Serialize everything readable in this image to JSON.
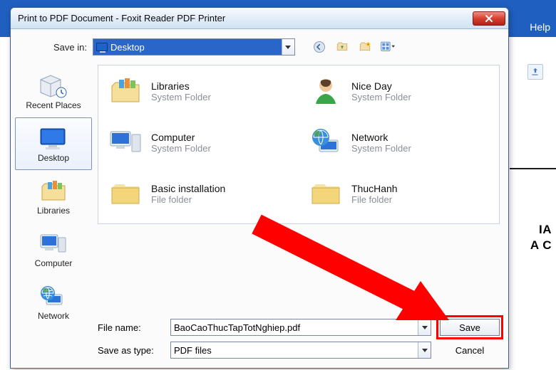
{
  "backdrop": {
    "help": "Help",
    "partial1": "IA",
    "partial2": "A C"
  },
  "dialog": {
    "title": "Print to PDF Document - Foxit Reader PDF Printer",
    "savein_label": "Save in:",
    "savein_value": "Desktop",
    "filename_label": "File name:",
    "filename_value": "BaoCaoThucTapTotNghiep.pdf",
    "filetype_label": "Save as type:",
    "filetype_value": "PDF files",
    "save_btn": "Save",
    "cancel_btn": "Cancel"
  },
  "places": [
    {
      "label": "Recent Places",
      "icon": "recent"
    },
    {
      "label": "Desktop",
      "icon": "desktop",
      "selected": true
    },
    {
      "label": "Libraries",
      "icon": "libraries"
    },
    {
      "label": "Computer",
      "icon": "computer"
    },
    {
      "label": "Network",
      "icon": "network"
    }
  ],
  "items": [
    {
      "name": "Libraries",
      "sub": "System Folder",
      "icon": "libraries"
    },
    {
      "name": "Nice Day",
      "sub": "System Folder",
      "icon": "user"
    },
    {
      "name": "Computer",
      "sub": "System Folder",
      "icon": "computer"
    },
    {
      "name": "Network",
      "sub": "System Folder",
      "icon": "network"
    },
    {
      "name": "Basic installation",
      "sub": "File folder",
      "icon": "folder"
    },
    {
      "name": "ThucHanh",
      "sub": "File folder",
      "icon": "folder"
    }
  ]
}
